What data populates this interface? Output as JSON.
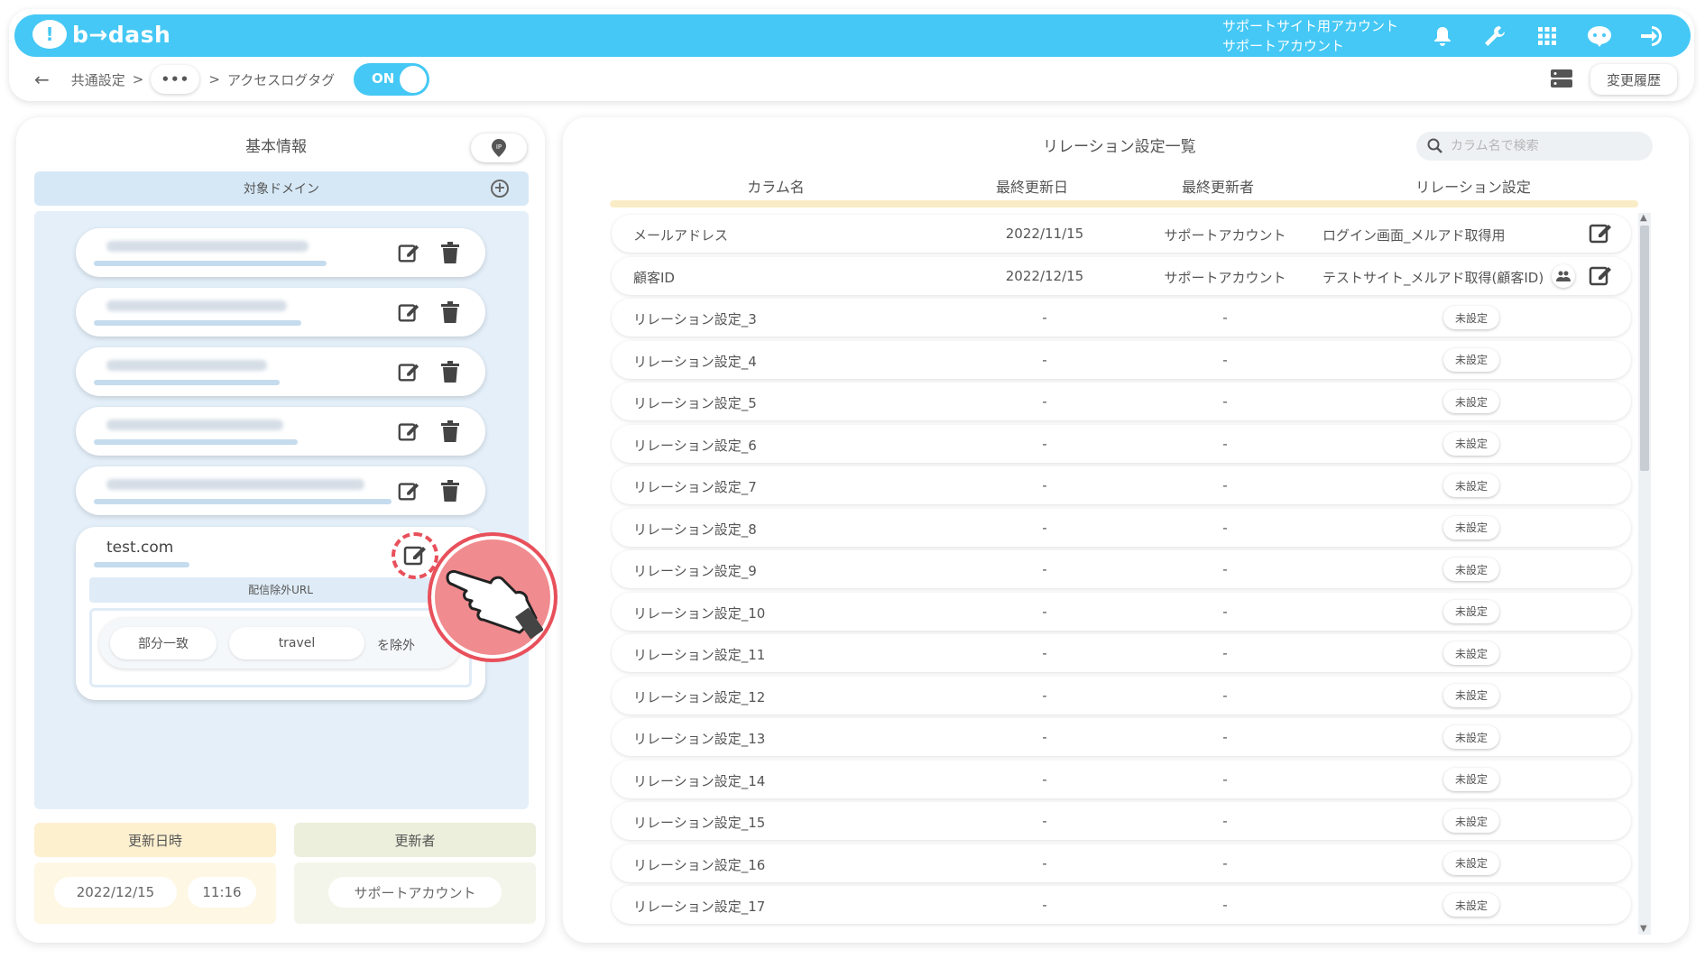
{
  "app": {
    "brand": "b→dash"
  },
  "header": {
    "account_line1": "サポートサイト用アカウント",
    "account_line2": "サポートアカウント",
    "icons": [
      "bell-icon",
      "wrench-icon",
      "apps-grid-icon",
      "chat-bot-icon",
      "logout-icon"
    ]
  },
  "breadcrumb": {
    "back": "←",
    "item1": "共通設定",
    "sep": ">",
    "ellipsis": "•••",
    "item3": "アクセスログタグ"
  },
  "toggle": {
    "label": "ON",
    "state": true
  },
  "history_button": "変更履歴",
  "left": {
    "title": "基本情報",
    "domain_header": "対象ドメイン",
    "domain_count_blurred": 5,
    "expanded": {
      "domain": "test.com",
      "exclude_header": "配信除外URL",
      "match_type": "部分一致",
      "keyword": "travel",
      "suffix": "を除外"
    },
    "updated_at_label": "更新日時",
    "updated_by_label": "更新者",
    "updated_date": "2022/12/15",
    "updated_time": "11:16",
    "updated_by": "サポートアカウント"
  },
  "right": {
    "title": "リレーション設定一覧",
    "search_placeholder": "カラム名で検索",
    "columns": [
      "カラム名",
      "最終更新日",
      "最終更新者",
      "リレーション設定"
    ],
    "unset_label": "未設定",
    "rows": [
      {
        "name": "メールアドレス",
        "date": "2022/11/15",
        "user": "サポートアカウント",
        "relation": "ログイン画面_メルアド取得用",
        "set": true
      },
      {
        "name": "顧客ID",
        "date": "2022/12/15",
        "user": "サポートアカウント",
        "relation": "テストサイト_メルアド取得(顧客ID)",
        "set": true,
        "people": true
      },
      {
        "name": "リレーション設定_3",
        "date": "-",
        "user": "-",
        "set": false
      },
      {
        "name": "リレーション設定_4",
        "date": "-",
        "user": "-",
        "set": false
      },
      {
        "name": "リレーション設定_5",
        "date": "-",
        "user": "-",
        "set": false
      },
      {
        "name": "リレーション設定_6",
        "date": "-",
        "user": "-",
        "set": false
      },
      {
        "name": "リレーション設定_7",
        "date": "-",
        "user": "-",
        "set": false
      },
      {
        "name": "リレーション設定_8",
        "date": "-",
        "user": "-",
        "set": false
      },
      {
        "name": "リレーション設定_9",
        "date": "-",
        "user": "-",
        "set": false
      },
      {
        "name": "リレーション設定_10",
        "date": "-",
        "user": "-",
        "set": false
      },
      {
        "name": "リレーション設定_11",
        "date": "-",
        "user": "-",
        "set": false
      },
      {
        "name": "リレーション設定_12",
        "date": "-",
        "user": "-",
        "set": false
      },
      {
        "name": "リレーション設定_13",
        "date": "-",
        "user": "-",
        "set": false
      },
      {
        "name": "リレーション設定_14",
        "date": "-",
        "user": "-",
        "set": false
      },
      {
        "name": "リレーション設定_15",
        "date": "-",
        "user": "-",
        "set": false
      },
      {
        "name": "リレーション設定_16",
        "date": "-",
        "user": "-",
        "set": false
      },
      {
        "name": "リレーション設定_17",
        "date": "-",
        "user": "-",
        "set": false
      }
    ]
  },
  "colors": {
    "accent": "#45c8f5",
    "highlight": "#e8505b",
    "panel_blue": "#e4eff9",
    "cream": "#fdf3dc",
    "olive": "#eef0e0"
  }
}
